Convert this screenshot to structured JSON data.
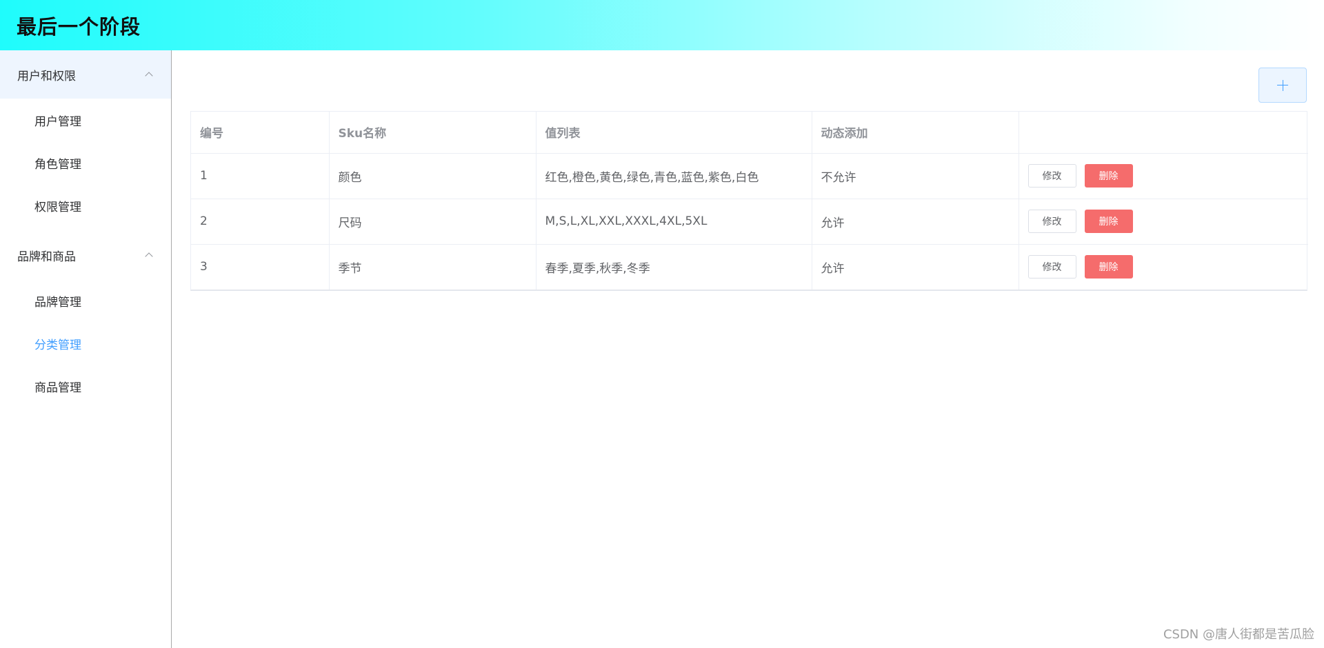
{
  "header": {
    "title": "最后一个阶段"
  },
  "sidebar": {
    "groups": [
      {
        "label": "用户和权限",
        "items": [
          {
            "label": "用户管理"
          },
          {
            "label": "角色管理"
          },
          {
            "label": "权限管理"
          }
        ]
      },
      {
        "label": "品牌和商品",
        "items": [
          {
            "label": "品牌管理"
          },
          {
            "label": "分类管理"
          },
          {
            "label": "商品管理"
          }
        ]
      }
    ],
    "active_item": "分类管理"
  },
  "toolbar": {
    "add_icon": "plus-icon"
  },
  "table": {
    "headers": [
      "编号",
      "Sku名称",
      "值列表",
      "动态添加",
      ""
    ],
    "rows": [
      {
        "id": "1",
        "name": "颜色",
        "values": "红色,橙色,黄色,绿色,青色,蓝色,紫色,白色",
        "dynamic": "不允许",
        "edit_label": "修改",
        "delete_label": "删除"
      },
      {
        "id": "2",
        "name": "尺码",
        "values": "M,S,L,XL,XXL,XXXL,4XL,5XL",
        "dynamic": "允许",
        "edit_label": "修改",
        "delete_label": "删除"
      },
      {
        "id": "3",
        "name": "季节",
        "values": "春季,夏季,秋季,冬季",
        "dynamic": "允许",
        "edit_label": "修改",
        "delete_label": "删除"
      }
    ]
  },
  "watermark": "CSDN @唐人街都是苦瓜脸",
  "colors": {
    "accent": "#409eff",
    "danger": "#f56c6c",
    "header_gradient_start": "#1ffcfc"
  }
}
